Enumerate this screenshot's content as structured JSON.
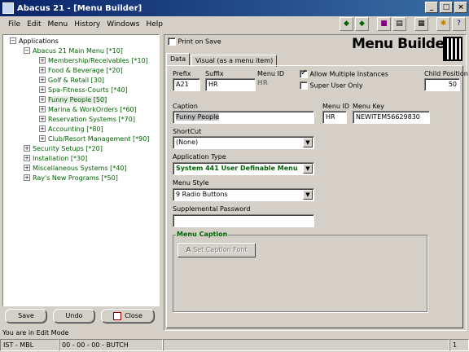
{
  "window": {
    "title": "Abacus 21 - [Menu Builder]"
  },
  "menubar": [
    "File",
    "Edit",
    "Menu",
    "History",
    "Windows",
    "Help"
  ],
  "tree": {
    "root": "Applications",
    "main_menu": "Abacus 21 Main Menu [*10]",
    "children": [
      "Membership/Receivables [*10]",
      "Food & Beverage [*20]",
      "Golf & Retail [30]",
      "Spa-Fitness-Courts [*40]",
      "Funny People [50]",
      "Marina & WorkOrders [*60]",
      "Reservation Systems [*70]",
      "Accounting [*80]",
      "Club/Resort Management [*90]"
    ],
    "others": [
      "Security Setups [*20]",
      "Installation [*30]",
      "Miscellaneous Systems [*40]",
      "Ray's New Programs [*50]"
    ]
  },
  "buttons": {
    "save": "Save",
    "undo": "Undo",
    "close": "Close"
  },
  "mode_text": "You are in Edit Mode",
  "statusbar": {
    "cell1": "IST - MBL",
    "cell2": "00 - 00 - 00 - BUTCH",
    "cell3": "",
    "cell4": "1"
  },
  "banner": "Menu Builder",
  "print_on_save": {
    "label": "Print on Save",
    "checked": false
  },
  "tabs": [
    "Data",
    "Visual (as a menu item)"
  ],
  "form": {
    "prefix_label": "Prefix",
    "prefix": "A21",
    "suffix_label": "Suffix",
    "suffix": "HR",
    "menu_id_label": "Menu ID",
    "menu_id_readonly": "HR",
    "allow_multiple_label": "Allow Multiple Instances",
    "super_user_label": "Super User Only",
    "child_position_label": "Child Position",
    "child_position": "50",
    "caption_label": "Caption",
    "caption": "Funny People",
    "menu_id2_label": "Menu ID",
    "menu_id2": "HR",
    "menu_key_label": "Menu Key",
    "menu_key": "NEWITEM56629830",
    "shortcut_label": "ShortCut",
    "shortcut": "(None)",
    "app_type_label": "Application Type",
    "app_type": "System 441 User Definable Menu",
    "menu_style_label": "Menu Style",
    "menu_style": "9 Radio Buttons",
    "supp_password_label": "Supplemental Password",
    "supp_password": "",
    "menu_caption_group": "Menu Caption",
    "set_caption_font": "Set Caption Font"
  }
}
